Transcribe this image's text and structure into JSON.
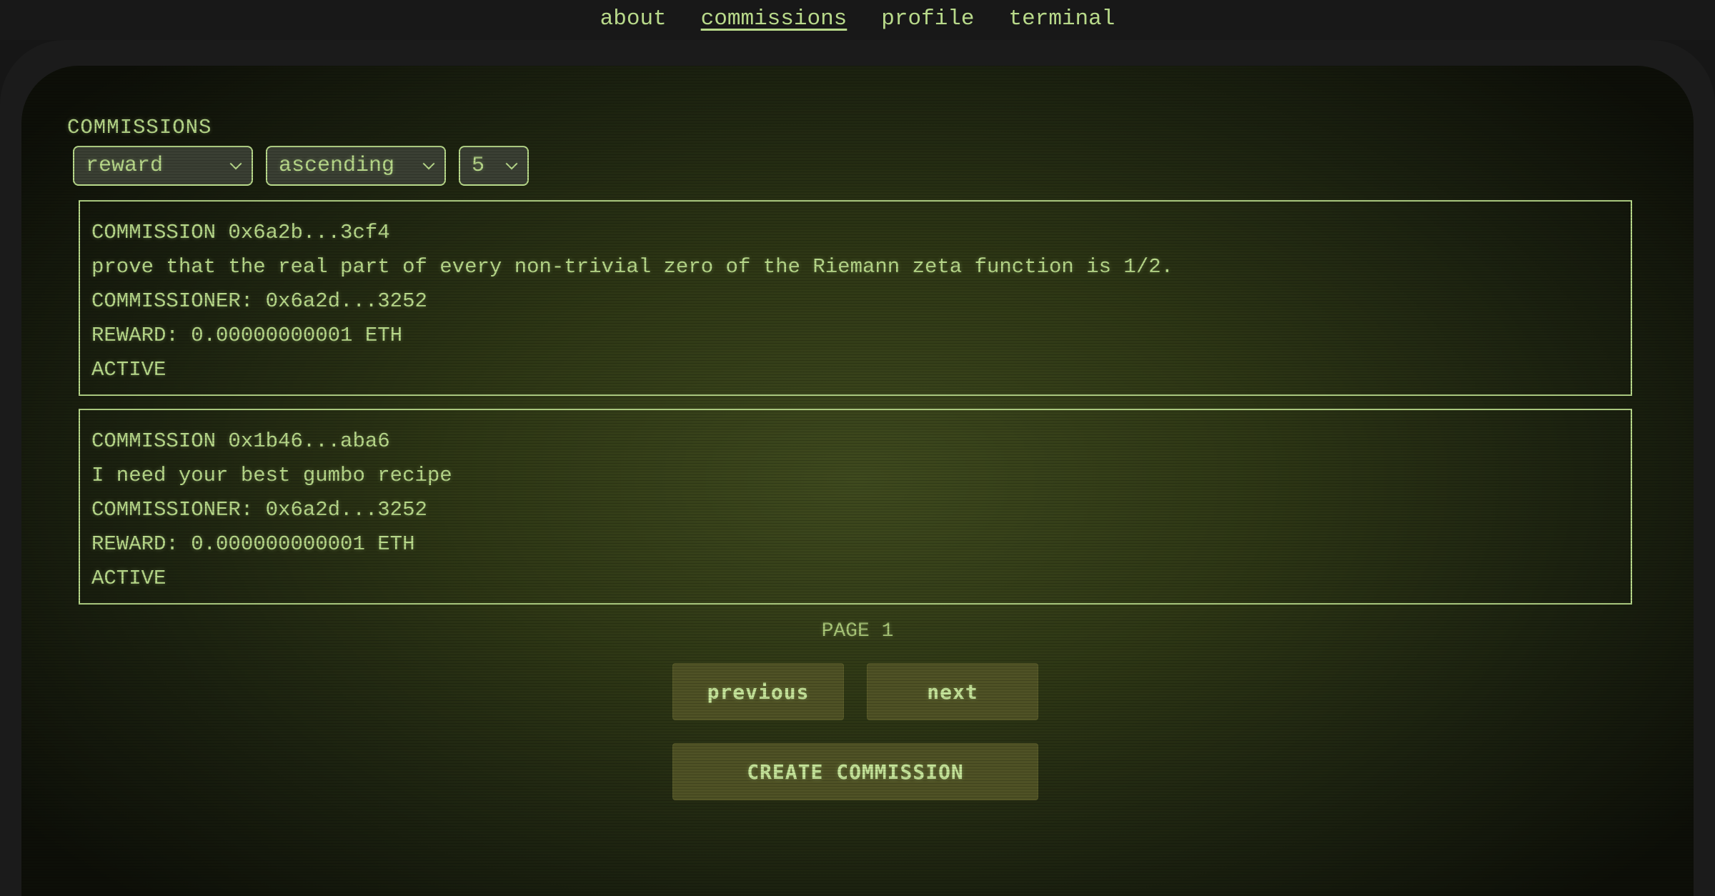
{
  "nav": {
    "items": [
      {
        "label": "about"
      },
      {
        "label": "commissions"
      },
      {
        "label": "profile"
      },
      {
        "label": "terminal"
      }
    ],
    "active": "commissions"
  },
  "main": {
    "title": "COMMISSIONS",
    "controls": {
      "sort_by": "reward",
      "order": "ascending",
      "page_size": "5"
    },
    "commissions": [
      {
        "header": "COMMISSION 0x6a2b...3cf4",
        "description": "prove that the real part of every non-trivial zero of the Riemann zeta function is 1/2.",
        "commissioner": "COMMISSIONER: 0x6a2d...3252",
        "reward": "REWARD: 0.00000000001 ETH",
        "status": "ACTIVE"
      },
      {
        "header": "COMMISSION 0x1b46...aba6",
        "description": "I need your best gumbo recipe",
        "commissioner": "COMMISSIONER: 0x6a2d...3252",
        "reward": "REWARD: 0.000000000001 ETH",
        "status": "ACTIVE"
      }
    ],
    "pagination": {
      "page_label": "PAGE 1",
      "previous_label": "previous",
      "next_label": "next"
    },
    "create_label": "CREATE COMMISSION"
  },
  "colors": {
    "phosphor": "#b8d98a",
    "button_bg": "#4f5225",
    "frame": "#1b1b1b"
  }
}
